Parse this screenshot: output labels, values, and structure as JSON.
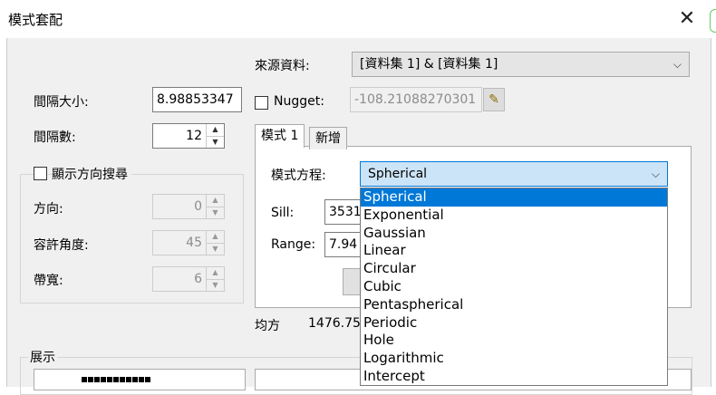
{
  "window": {
    "title": "模式套配",
    "close_glyph": "✕"
  },
  "source": {
    "label": "來源資料:",
    "value": "[資料集 1] & [資料集 1]"
  },
  "lag_size": {
    "label": "間隔大小:",
    "value": "8.98853347"
  },
  "lag_count": {
    "label": "間隔數:",
    "value": "12"
  },
  "nugget": {
    "label": "Nugget:",
    "value": "-108.21088270301",
    "checked": false
  },
  "direction_search": {
    "label": "顯示方向搜尋",
    "checked": false,
    "direction": {
      "label": "方向:",
      "value": "0"
    },
    "tolerance": {
      "label": "容許角度:",
      "value": "45"
    },
    "bandwidth": {
      "label": "帶寬:",
      "value": "6"
    }
  },
  "tabs": [
    {
      "label": "模式 1"
    },
    {
      "label": "新增"
    }
  ],
  "model": {
    "equation_label": "模式方程:",
    "selected": "Spherical",
    "sill_label": "Sill:",
    "sill_value": "3531",
    "range_label": "Range:",
    "range_value": "7.94",
    "options": [
      "Spherical",
      "Exponential",
      "Gaussian",
      "Linear",
      "Circular",
      "Cubic",
      "Pentaspherical",
      "Periodic",
      "Hole",
      "Logarithmic",
      "Intercept"
    ]
  },
  "mean_square": {
    "label": "均方",
    "value": "1476.75"
  },
  "display": {
    "label": "展示"
  },
  "icons": {
    "close": "close-icon",
    "edit": "pencil-icon",
    "dropdown": "chevron-down-icon"
  }
}
